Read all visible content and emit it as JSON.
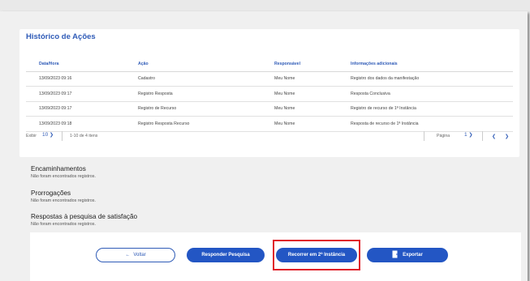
{
  "history": {
    "title": "Histórico de Ações",
    "columns": [
      "Data/Hora",
      "Ação",
      "Responsável",
      "Informações adicionais"
    ],
    "rows": [
      [
        "13/09/2023 09:16",
        "Cadastro",
        "Meu Nome",
        "Registro dos dados da manifestação"
      ],
      [
        "13/09/2023 09:17",
        "Registro Resposta",
        "Meu Nome",
        "Resposta Conclusiva"
      ],
      [
        "13/09/2023 09:17",
        "Registro de Recurso",
        "Meu Nome",
        "Registro de recurso de 1ª Instância"
      ],
      [
        "13/09/2023 09:18",
        "Registro Resposta Recurso",
        "Meu Nome",
        "Resposta de recurso de 1ª Instância"
      ]
    ],
    "pagination": {
      "show_label": "Exibir",
      "page_size": "10",
      "range_text": "1-10 de 4 itens",
      "page_label": "Página",
      "page_value": "1"
    }
  },
  "sections": {
    "forwardings": {
      "title": "Encaminhamentos",
      "empty_text": "Não foram encontrados registros."
    },
    "extensions": {
      "title": "Prorrogações",
      "empty_text": "Não foram encontrados registros."
    },
    "survey": {
      "title": "Respostas à pesquisa de satisfação",
      "empty_text": "Não foram encontrados registros."
    }
  },
  "actions": {
    "back_label": "Voltar",
    "respond_survey_label": "Responder Pesquisa",
    "appeal_label": "Recorrer em 2ª Instância",
    "export_label": "Exportar"
  },
  "colors": {
    "primary": "#2356c4",
    "highlight": "#e0202a"
  }
}
